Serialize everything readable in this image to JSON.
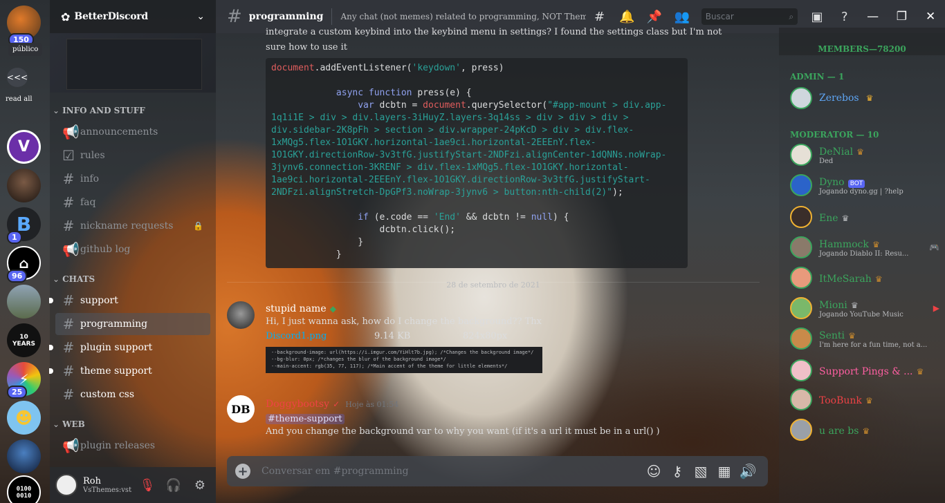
{
  "rail": {
    "top_badge": "150",
    "publico_label": "público",
    "collapse_label": "<<<",
    "read_all_label": "read all",
    "servers": [
      {
        "name": "server-violet-v",
        "badge": ""
      },
      {
        "name": "server-portrait",
        "badge": ""
      },
      {
        "name": "server-b-camera",
        "badge": "1"
      },
      {
        "name": "server-bw-logo",
        "badge": "96"
      },
      {
        "name": "server-landscape",
        "badge": ""
      },
      {
        "name": "server-10-years",
        "badge": "",
        "text": "10\nYEARS"
      },
      {
        "name": "server-rainbow-plug",
        "badge": "25"
      },
      {
        "name": "server-smiley",
        "badge": ""
      },
      {
        "name": "server-blue-figure",
        "badge": ""
      },
      {
        "name": "server-binary",
        "badge": "",
        "text": "0100\n0010"
      }
    ]
  },
  "sidebar": {
    "guild_name": "BetterDiscord",
    "categories": {
      "info": "INFO AND STUFF",
      "chats": "CHATS",
      "web": "WEB"
    },
    "info_channels": [
      "announcements",
      "rules",
      "info",
      "faq",
      "nickname requests",
      "github log"
    ],
    "chat_channels": [
      "support",
      "programming",
      "plugin support",
      "theme support",
      "custom css"
    ],
    "web_channels": [
      "plugin releases"
    ]
  },
  "user": {
    "name": "Roh",
    "status": "VsThemes:vsthe..."
  },
  "header": {
    "channel": "programming",
    "topic": "Any chat (not memes) related to programming, NOT Themes and...",
    "search_placeholder": "Buscar"
  },
  "chat": {
    "prev_text": "integrate a custom keybind into the keybind menu in settings? I found the settings class but I'm not sure how to use it",
    "date_divider": "28 de setembro de 2021",
    "msg1": {
      "author": "stupid name",
      "text": "Hi, I just wanna ask, how do I change the background?? Thx",
      "file_name": "Discord1.png",
      "file_size": "9.14 KB",
      "file_dims": "824x80px",
      "attach_lines": [
        "--background-image: url(https://i.imgur.com/YiHlt7b.jpg); /*Changes the background image*/",
        "--bg-blur: 0px; /*changes the blur of the background image*/",
        "--main-accent: rgb(35, 77, 117); /*Main accent of the theme for little elements*/"
      ]
    },
    "msg2": {
      "author": "Doggybootsy",
      "timestamp": "Hoje às 01:54",
      "mention": "theme-support",
      "text": "And you change the background var to why you want (if it's a url it must be in a url() )"
    },
    "composer_placeholder": "Conversar em #programming"
  },
  "members": {
    "header": "MEMBERS—78200",
    "admin_role": "ADMIN — 1",
    "mod_role": "MODERATOR — 10",
    "list": [
      {
        "name": "Zerebos",
        "status": "",
        "color": "#5ea6f5"
      },
      {
        "name": "DeNial",
        "status": "Ded",
        "color": "#3ba55d"
      },
      {
        "name": "Dyno",
        "status": "Jogando dyno.gg | ?help",
        "color": "#3ba55d",
        "bot": "BOT"
      },
      {
        "name": "Ene",
        "status": "",
        "color": "#3ba55d"
      },
      {
        "name": "Hammock",
        "status": "Jogando Diablo II: Resu...",
        "color": "#3ba55d"
      },
      {
        "name": "ItMeSarah",
        "status": "",
        "color": "#3ba55d"
      },
      {
        "name": "Mioni",
        "status": "Jogando YouTube Music",
        "color": "#3ba55d"
      },
      {
        "name": "Senti",
        "status": "I'm here for a fun time, not a...",
        "color": "#3ba55d"
      },
      {
        "name": "Support Pings & ...",
        "status": "",
        "color": "#ff5fa2"
      },
      {
        "name": "TooBunk",
        "status": "",
        "color": "#ed4245"
      },
      {
        "name": "u are bs",
        "status": "",
        "color": "#3ba55d"
      }
    ]
  },
  "colors": {
    "accent": "#5865f2",
    "online": "#3ba55d",
    "doggy": "#ed4245"
  }
}
